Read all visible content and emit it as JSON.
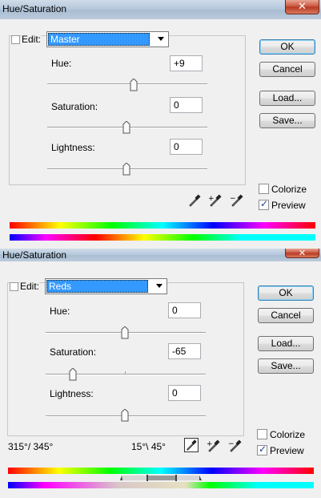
{
  "dialog1": {
    "title": "Hue/Saturation",
    "edit_label": "Edit:",
    "edit_value": "Master",
    "hue": {
      "label": "Hue:",
      "value": "+9"
    },
    "saturation": {
      "label": "Saturation:",
      "value": "0"
    },
    "lightness": {
      "label": "Lightness:",
      "value": "0"
    },
    "buttons": {
      "ok": "OK",
      "cancel": "Cancel",
      "load": "Load...",
      "save": "Save..."
    },
    "colorize": {
      "label": "Colorize",
      "checked": false
    },
    "preview": {
      "label": "Preview",
      "checked": true
    }
  },
  "dialog2": {
    "title": "Hue/Saturation",
    "edit_label": "Edit:",
    "edit_value": "Reds",
    "hue": {
      "label": "Hue:",
      "value": "0"
    },
    "saturation": {
      "label": "Saturation:",
      "value": "-65"
    },
    "lightness": {
      "label": "Lightness:",
      "value": "0"
    },
    "buttons": {
      "ok": "OK",
      "cancel": "Cancel",
      "load": "Load...",
      "save": "Save..."
    },
    "colorize": {
      "label": "Colorize",
      "checked": false
    },
    "preview": {
      "label": "Preview",
      "checked": true
    },
    "range_left": "315°/ 345°",
    "range_right": "15°\\ 45°"
  },
  "icons": {
    "close": "close-icon",
    "eyedropper": "eyedropper-icon",
    "eyedropper_plus": "eyedropper-plus-icon",
    "eyedropper_minus": "eyedropper-minus-icon",
    "slider_thumb": "slider-thumb-icon"
  },
  "colors": {
    "selection": "#3399ff",
    "close_button": "#c7503a",
    "titlebar": "#b7c9dd"
  }
}
